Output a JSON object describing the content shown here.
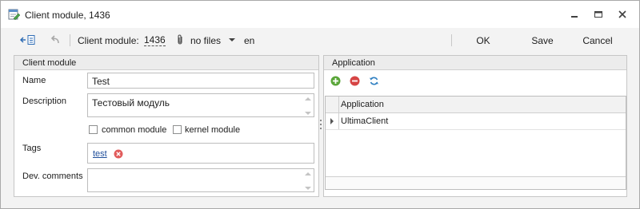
{
  "window": {
    "title": "Client module, 1436",
    "icon": "module-edit-icon",
    "controls": [
      "minimize-icon",
      "maximize-icon",
      "close-icon"
    ]
  },
  "toolbar": {
    "entity_label": "Client module:",
    "entity_id": "1436",
    "files_label": "no files",
    "language": "en",
    "ok_label": "OK",
    "save_label": "Save",
    "cancel_label": "Cancel"
  },
  "client_module": {
    "header": "Client module",
    "name_label": "Name",
    "name_value": "Test",
    "description_label": "Description",
    "description_value": "Тестовый модуль",
    "common_module_label": "common module",
    "common_module_checked": false,
    "kernel_module_label": "kernel module",
    "kernel_module_checked": false,
    "tags_label": "Tags",
    "tags": [
      "test"
    ],
    "dev_comments_label": "Dev. comments",
    "dev_comments_value": ""
  },
  "application": {
    "header": "Application",
    "actions": [
      "add-icon",
      "remove-icon",
      "refresh-icon"
    ],
    "column_header": "Application",
    "rows": [
      "UltimaClient"
    ],
    "colors": {
      "add": "#5aa63a",
      "remove": "#d64545",
      "refresh": "#2f7fc1"
    }
  }
}
